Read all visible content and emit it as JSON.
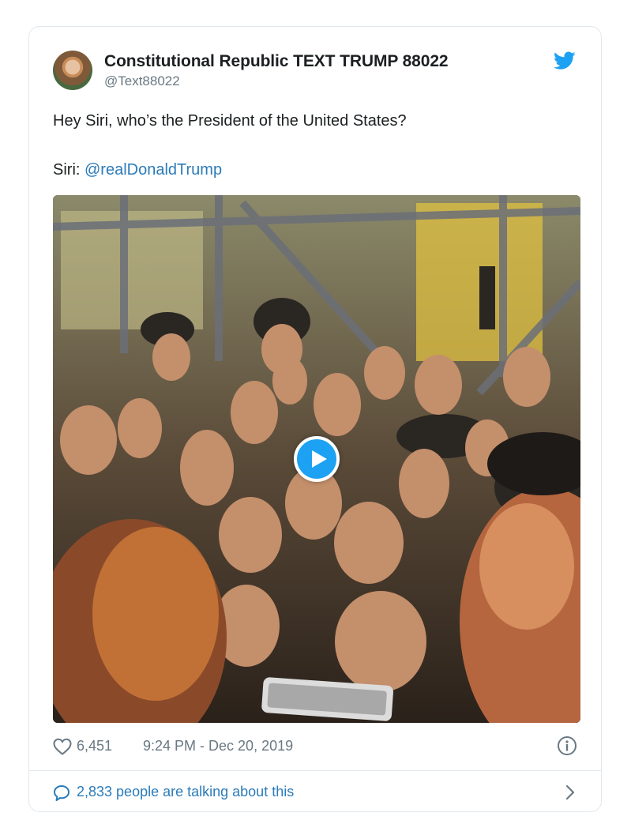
{
  "tweet": {
    "display_name": "Constitutional Republic TEXT TRUMP 88022",
    "handle": "@Text88022",
    "text_line1": "Hey Siri, who’s the President of the United States?",
    "text_line2_prefix": "Siri: ",
    "mention": "@realDonaldTrump",
    "likes": "6,451",
    "timestamp": "9:24 PM - Dec 20, 2019",
    "talking": "2,833 people are talking about this"
  },
  "icons": {
    "brand": "twitter-bird-icon",
    "like": "heart-icon",
    "info": "info-icon",
    "reply": "speech-bubble-icon",
    "more": "chevron-right-icon",
    "play": "play-icon"
  },
  "colors": {
    "accent": "#1da1f2",
    "link": "#2b7bb9",
    "muted": "#697882",
    "border": "#e1e8ed"
  }
}
